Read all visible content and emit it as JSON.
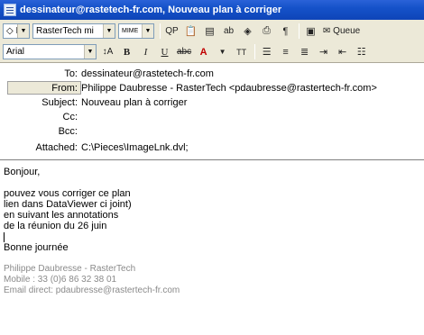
{
  "window": {
    "title": "dessinateur@rastetech-fr.com, Nouveau plan à corriger"
  },
  "toolbar1": {
    "style_combo": "RasterTech mi",
    "mime_combo": "MIME",
    "buttons": [
      "QP",
      "Queue"
    ]
  },
  "toolbar2": {
    "font_combo": "Arial",
    "bold": "B",
    "italic": "I",
    "underline": "U",
    "size_label": "A"
  },
  "header": {
    "to_label": "To:",
    "to_value": "dessinateur@rastetech-fr.com",
    "from_label": "From:",
    "from_value": "Philippe Daubresse - RasterTech <pdaubresse@rastertech-fr.com>",
    "subject_label": "Subject:",
    "subject_value": "Nouveau plan à corriger",
    "cc_label": "Cc:",
    "bcc_label": "Bcc:",
    "attached_label": "Attached:",
    "attached_value": "C:\\Pieces\\ImageLnk.dvl;"
  },
  "body": {
    "greeting": "Bonjour,",
    "lines": [
      "pouvez vous corriger ce plan",
      "lien dans DataViewer ci joint)",
      "en suivant les annotations",
      "de la réunion du 26 juin"
    ],
    "closing": "Bonne journée",
    "signature": [
      "Philippe Daubresse - RasterTech",
      "Mobile : 33 (0)6 86 32 38 01",
      "Email direct: pdaubresse@rastertech-fr.com"
    ]
  }
}
